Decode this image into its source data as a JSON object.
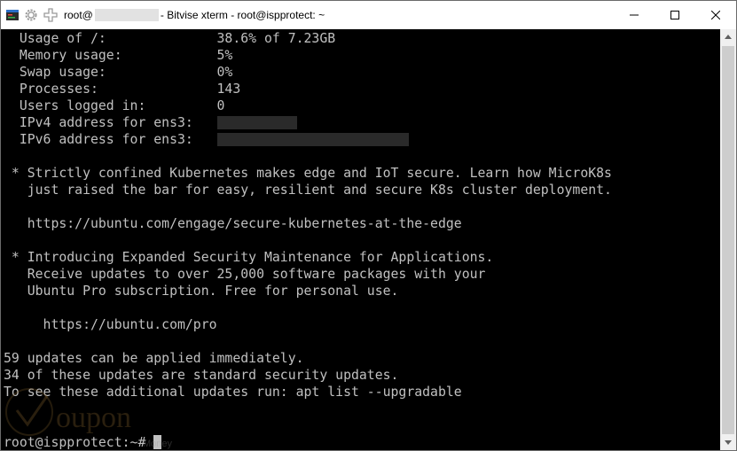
{
  "titlebar": {
    "prefix": "root@",
    "suffix": " - Bitvise xterm - root@ispprotect: ~",
    "icons": [
      "bitvise-app-icon",
      "gear-icon",
      "move-icon"
    ]
  },
  "window_controls": [
    "minimize-icon",
    "maximize-icon",
    "close-icon"
  ],
  "terminal": {
    "lines": [
      {
        "text": "  Usage of /:              38.6% of 7.23GB"
      },
      {
        "text": "  Memory usage:            5%"
      },
      {
        "text": "  Swap usage:              0%"
      },
      {
        "text": "  Processes:               143"
      },
      {
        "text": "  Users logged in:         0"
      },
      {
        "text": "  IPv4 address for ens3:   ",
        "redacted_chars": 10
      },
      {
        "text": "  IPv6 address for ens3:   ",
        "redacted_chars": 24
      },
      {
        "text": ""
      },
      {
        "text": " * Strictly confined Kubernetes makes edge and IoT secure. Learn how MicroK8s"
      },
      {
        "text": "   just raised the bar for easy, resilient and secure K8s cluster deployment."
      },
      {
        "text": ""
      },
      {
        "text": "   https://ubuntu.com/engage/secure-kubernetes-at-the-edge"
      },
      {
        "text": ""
      },
      {
        "text": " * Introducing Expanded Security Maintenance for Applications."
      },
      {
        "text": "   Receive updates to over 25,000 software packages with your"
      },
      {
        "text": "   Ubuntu Pro subscription. Free for personal use."
      },
      {
        "text": ""
      },
      {
        "text": "     https://ubuntu.com/pro"
      },
      {
        "text": ""
      },
      {
        "text": "59 updates can be applied immediately."
      },
      {
        "text": "34 of these updates are standard security updates."
      },
      {
        "text": "To see these additional updates run: apt list --upgradable"
      },
      {
        "text": ""
      },
      {
        "text": ""
      },
      {
        "text": "root@ispprotect:~# ",
        "cursor": true
      }
    ]
  },
  "watermark": {
    "text": "oupon",
    "small_text": "Money"
  },
  "colors": {
    "terminal_bg": "#000000",
    "terminal_fg": "#c0c0c0",
    "titlebar_bg": "#ffffff",
    "scrollbar_bg": "#f0f0f0"
  }
}
